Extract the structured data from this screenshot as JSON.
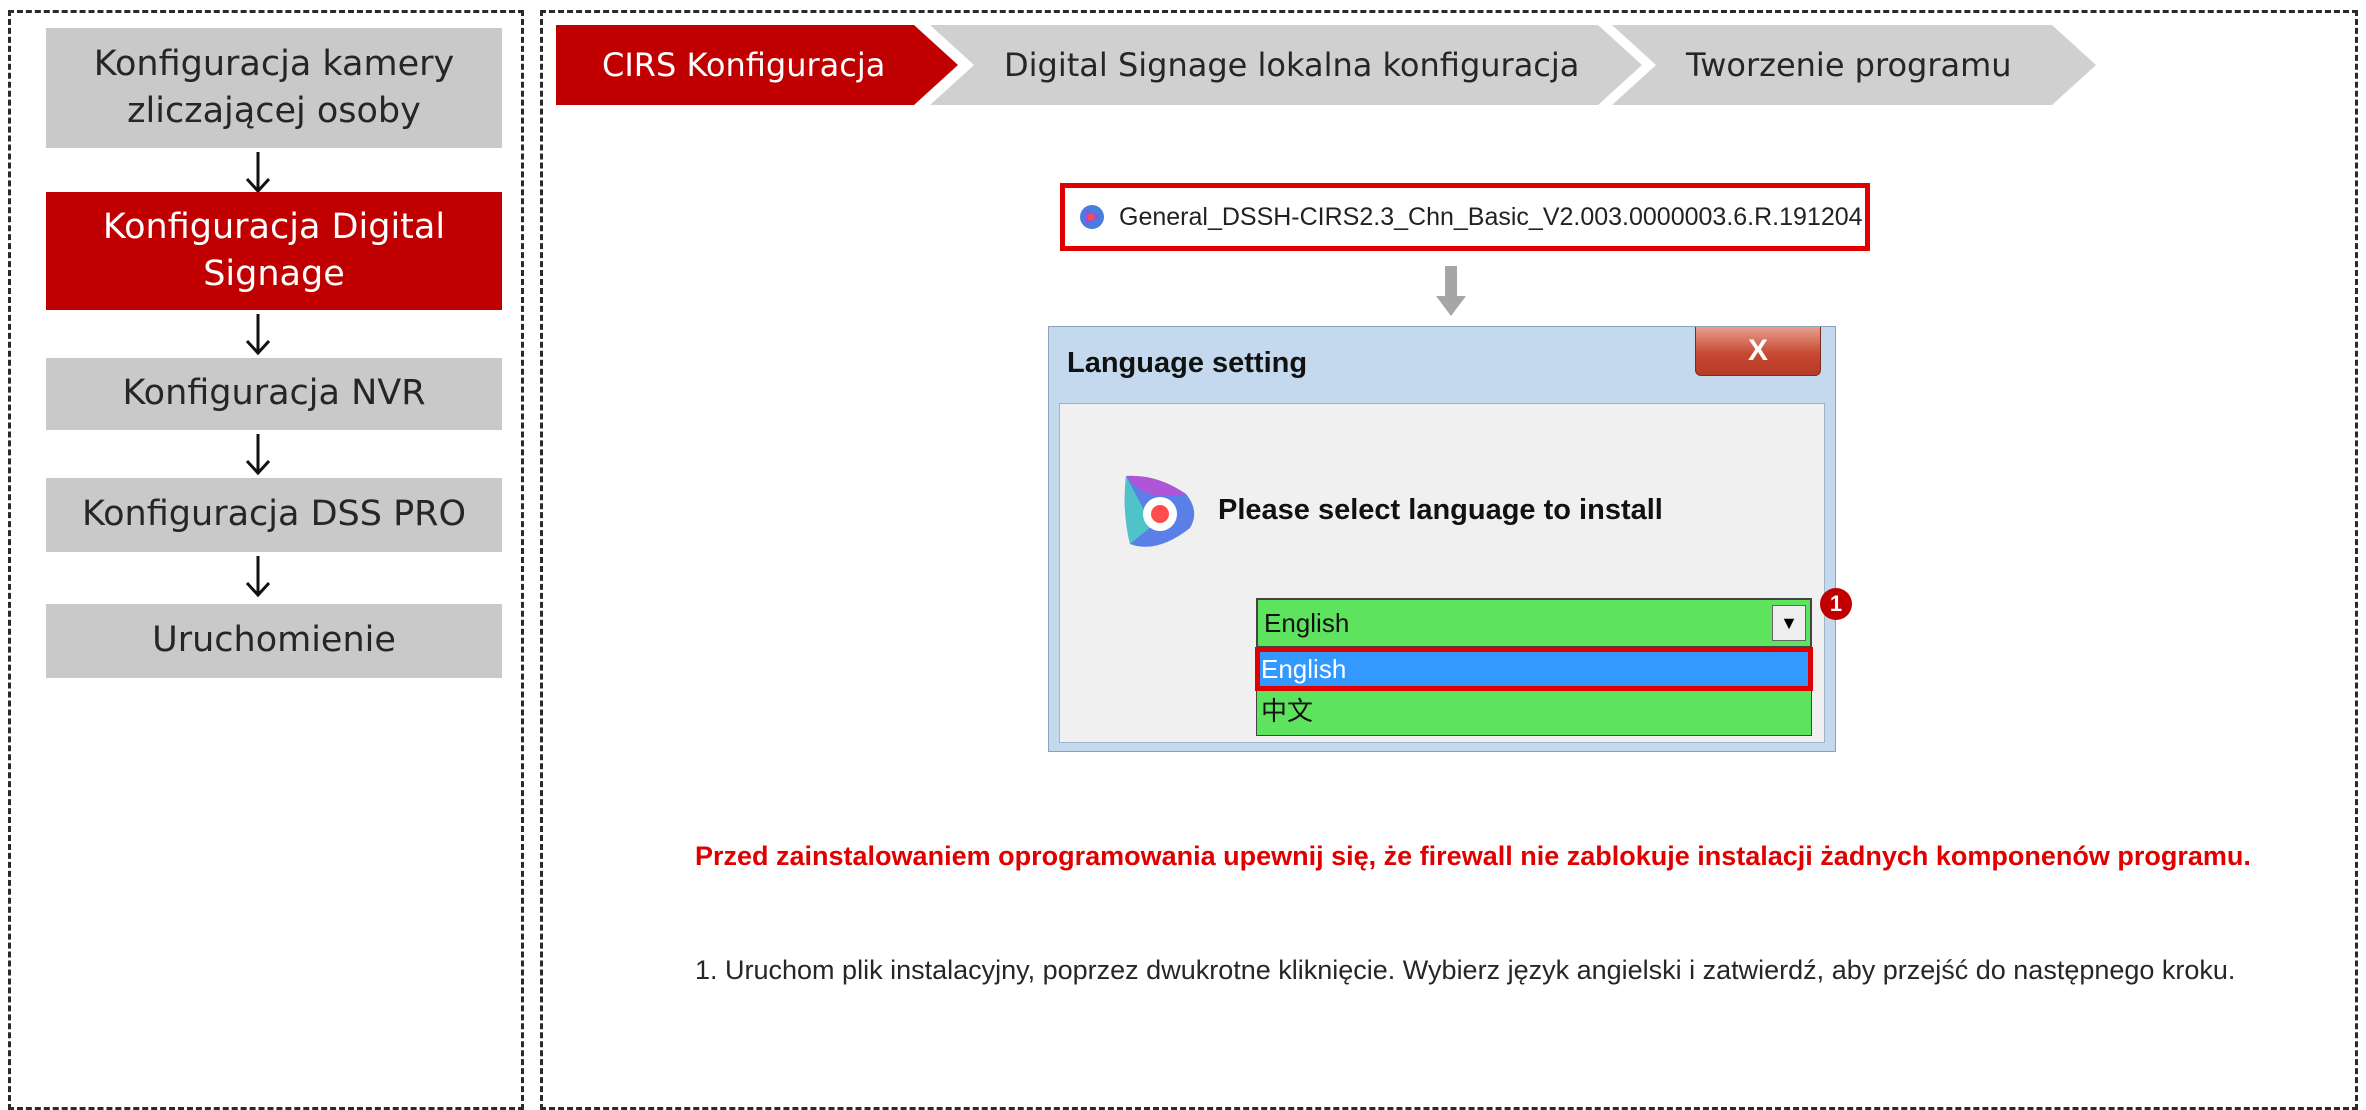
{
  "sidebar": {
    "steps": [
      {
        "label": "Konfiguracja kamery zliczającej osoby",
        "active": false
      },
      {
        "label": "Konfiguracja Digital Signage",
        "active": true
      },
      {
        "label": "Konfiguracja NVR",
        "active": false
      },
      {
        "label": "Konfiguracja DSS PRO",
        "active": false
      },
      {
        "label": "Uruchomienie",
        "active": false
      }
    ]
  },
  "breadcrumb": {
    "items": [
      {
        "label": "CIRS Konfiguracja",
        "active": true
      },
      {
        "label": "Digital Signage lokalna konfiguracja",
        "active": false
      },
      {
        "label": "Tworzenie programu",
        "active": false
      }
    ]
  },
  "installer": {
    "file_name": "General_DSSH-CIRS2.3_Chn_Basic_V2.003.0000003.6.R.191204"
  },
  "dialog": {
    "title": "Language setting",
    "close_label": "X",
    "prompt": "Please select language to install",
    "selected_value": "English",
    "options": [
      "English",
      "中文"
    ],
    "callout": "1"
  },
  "notes": {
    "warning": "Przed zainstalowaniem oprogramowania upewnij się, że firewall nie zablokuje instalacji żadnych komponenów programu.",
    "instruction": "1. Uruchom plik instalacyjny, poprzez dwukrotne kliknięcie. Wybierz język angielski i zatwierdź, aby przejść do następnego kroku."
  },
  "colors": {
    "accent": "#c00000",
    "inactive": "#c9c9c9",
    "select_green": "#5ee35e",
    "highlight_blue": "#3399ff"
  }
}
